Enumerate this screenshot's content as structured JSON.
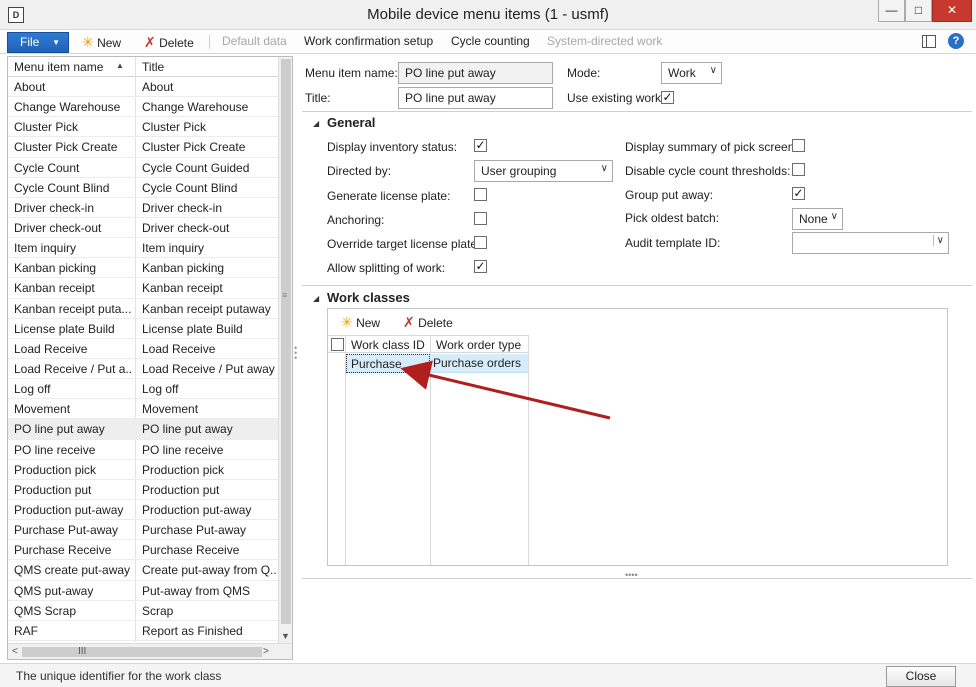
{
  "window": {
    "title": "Mobile device menu items (1 - usmf)",
    "app_icon": "D"
  },
  "toolbar": {
    "file_label": "File",
    "new_label": "New",
    "delete_label": "Delete",
    "default_data_label": "Default data",
    "work_confirmation_label": "Work confirmation setup",
    "cycle_counting_label": "Cycle counting",
    "system_directed_label": "System-directed work"
  },
  "list": {
    "col1_header": "Menu item name",
    "col2_header": "Title",
    "rows": [
      {
        "name": "About",
        "title": "About"
      },
      {
        "name": "Change Warehouse",
        "title": "Change Warehouse"
      },
      {
        "name": "Cluster Pick",
        "title": "Cluster Pick"
      },
      {
        "name": "Cluster Pick Create",
        "title": "Cluster Pick Create"
      },
      {
        "name": "Cycle Count",
        "title": "Cycle Count Guided"
      },
      {
        "name": "Cycle Count Blind",
        "title": "Cycle Count Blind"
      },
      {
        "name": "Driver check-in",
        "title": "Driver check-in"
      },
      {
        "name": "Driver check-out",
        "title": "Driver check-out"
      },
      {
        "name": "Item inquiry",
        "title": "Item inquiry"
      },
      {
        "name": "Kanban picking",
        "title": "Kanban picking"
      },
      {
        "name": "Kanban receipt",
        "title": "Kanban receipt"
      },
      {
        "name": "Kanban receipt puta...",
        "title": "Kanban receipt putaway"
      },
      {
        "name": "License plate Build",
        "title": "License plate Build"
      },
      {
        "name": "Load Receive",
        "title": "Load Receive"
      },
      {
        "name": "Load Receive / Put a...",
        "title": "Load Receive / Put away"
      },
      {
        "name": "Log off",
        "title": "Log off"
      },
      {
        "name": "Movement",
        "title": "Movement"
      },
      {
        "name": "PO line put away",
        "title": "PO line put away"
      },
      {
        "name": "PO line receive",
        "title": "PO line receive"
      },
      {
        "name": "Production pick",
        "title": "Production pick"
      },
      {
        "name": "Production put",
        "title": "Production put"
      },
      {
        "name": "Production put-away",
        "title": "Production put-away"
      },
      {
        "name": "Purchase Put-away",
        "title": "Purchase Put-away"
      },
      {
        "name": "Purchase Receive",
        "title": "Purchase Receive"
      },
      {
        "name": "QMS create put-away",
        "title": "Create put-away from Q..."
      },
      {
        "name": "QMS put-away",
        "title": "Put-away from QMS"
      },
      {
        "name": "QMS Scrap",
        "title": "Scrap"
      },
      {
        "name": "RAF",
        "title": "Report as Finished"
      }
    ],
    "selected_index": 17,
    "hscroll_grip": "III"
  },
  "header_form": {
    "menu_item_name_label": "Menu item name:",
    "menu_item_name_value": "PO line put away",
    "title_label": "Title:",
    "title_value": "PO line put away",
    "mode_label": "Mode:",
    "mode_value": "Work",
    "use_existing_work_label": "Use existing work:",
    "use_existing_work_checked": true
  },
  "general": {
    "section_title": "General",
    "display_inventory_status_label": "Display inventory status:",
    "display_inventory_status_checked": true,
    "directed_by_label": "Directed by:",
    "directed_by_value": "User grouping",
    "generate_license_plate_label": "Generate license plate:",
    "generate_license_plate_checked": false,
    "anchoring_label": "Anchoring:",
    "anchoring_checked": false,
    "override_target_lp_label": "Override target license plate:",
    "override_target_lp_checked": false,
    "allow_splitting_label": "Allow splitting of work:",
    "allow_splitting_checked": true,
    "display_summary_label": "Display summary of pick screen:",
    "display_summary_checked": false,
    "disable_cc_thresholds_label": "Disable cycle count thresholds:",
    "disable_cc_thresholds_checked": false,
    "group_put_away_label": "Group put away:",
    "group_put_away_checked": true,
    "pick_oldest_batch_label": "Pick oldest batch:",
    "pick_oldest_batch_value": "None",
    "audit_template_label": "Audit template ID:",
    "audit_template_value": ""
  },
  "work_classes": {
    "section_title": "Work classes",
    "new_label": "New",
    "delete_label": "Delete",
    "col_work_class_id": "Work class ID",
    "col_work_order_type": "Work order type",
    "rows": [
      {
        "work_class_id": "Purchase",
        "work_order_type": "Purchase orders"
      }
    ]
  },
  "status": {
    "text": "The unique identifier for the work class",
    "close_label": "Close"
  },
  "colors": {
    "file_button": "#1f62b6",
    "selected_row": "#d6ecfa",
    "annotation_arrow": "#b01e1e",
    "close_window": "#c7392e"
  }
}
